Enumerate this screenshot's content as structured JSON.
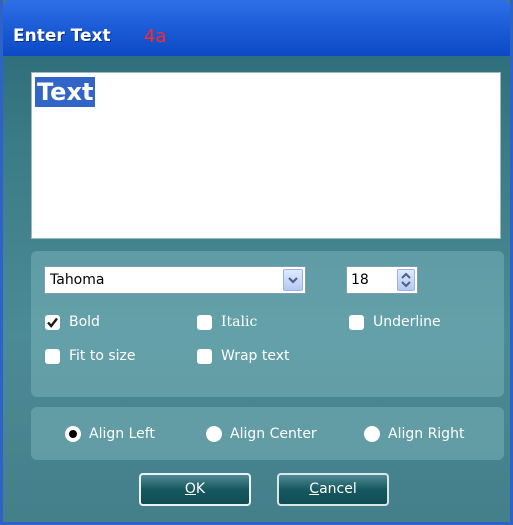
{
  "window": {
    "title": "Enter Text",
    "annotation": "4a"
  },
  "editor": {
    "selected_text": "Text"
  },
  "font": {
    "name": "Tahoma",
    "size": "18"
  },
  "style_options": [
    {
      "label": "Bold",
      "checked": true
    },
    {
      "label": "Italic",
      "checked": false
    },
    {
      "label": "Underline",
      "checked": false
    },
    {
      "label": "Fit to size",
      "checked": false
    },
    {
      "label": "Wrap text",
      "checked": false
    }
  ],
  "alignment": [
    {
      "label": "Align Left",
      "selected": true
    },
    {
      "label": "Align Center",
      "selected": false
    },
    {
      "label": "Align Right",
      "selected": false
    }
  ],
  "buttons": {
    "ok": {
      "mnemonic": "O",
      "rest": "K"
    },
    "cancel": {
      "mnemonic": "C",
      "rest": "ancel"
    }
  },
  "colors": {
    "titlebar": "#0c49c6",
    "dialog_body": "#3f7b86",
    "selection": "#3166c8",
    "annotation": "#ff2a2a"
  }
}
